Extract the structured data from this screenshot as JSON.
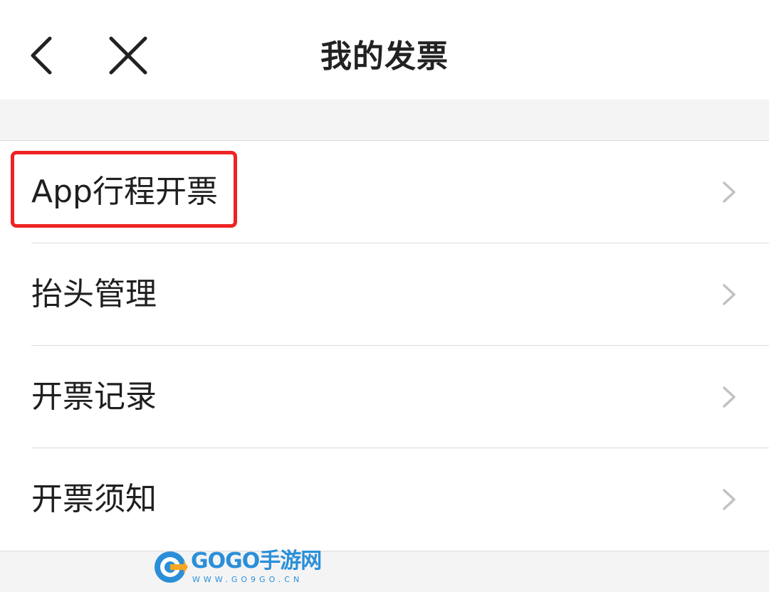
{
  "nav": {
    "title": "我的发票",
    "back_icon": "chevron-left-icon",
    "close_icon": "close-icon"
  },
  "menu": {
    "items": [
      {
        "label": "App行程开票",
        "icon": "chevron-right-icon"
      },
      {
        "label": "抬头管理",
        "icon": "chevron-right-icon"
      },
      {
        "label": "开票记录",
        "icon": "chevron-right-icon"
      },
      {
        "label": "开票须知",
        "icon": "chevron-right-icon"
      }
    ]
  },
  "highlight": {
    "color": "#ee2323"
  },
  "watermark": {
    "text": "GOGO手游网",
    "url": "WWW.GO9GO.CN",
    "color": "#2b8fd8"
  }
}
